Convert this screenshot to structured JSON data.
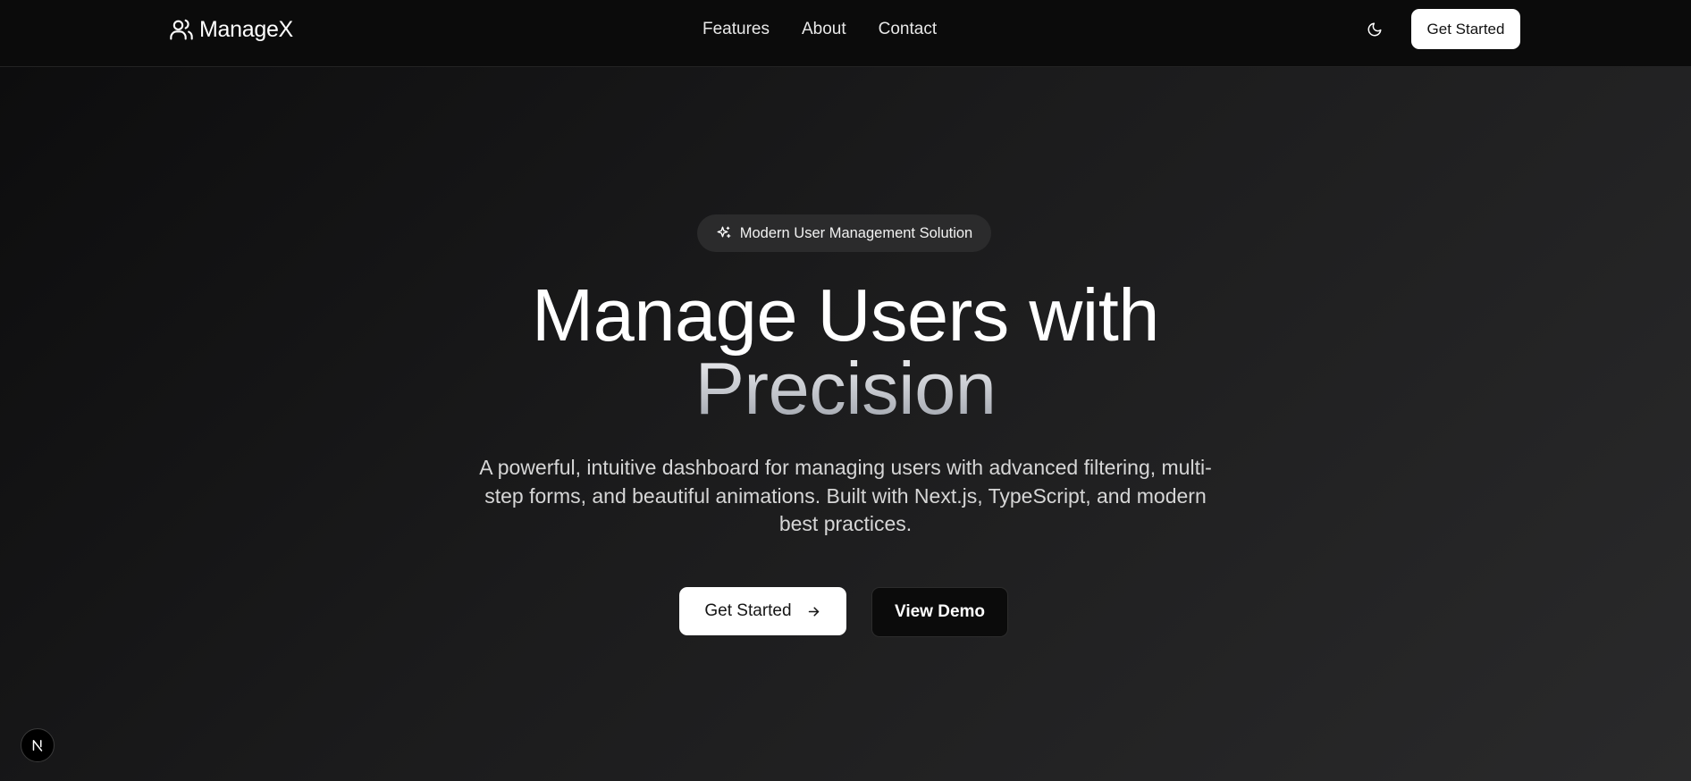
{
  "header": {
    "brand": {
      "name": "ManageX",
      "icon": "users-icon"
    },
    "nav": [
      {
        "label": "Features"
      },
      {
        "label": "About"
      },
      {
        "label": "Contact"
      }
    ],
    "theme_toggle_icon": "moon-icon",
    "cta_label": "Get Started"
  },
  "hero": {
    "badge": {
      "icon": "sparkles-icon",
      "label": "Modern User Management Solution"
    },
    "title_line1": "Manage Users with",
    "title_line2": "Precision",
    "description": "A powerful, intuitive dashboard for managing users with advanced filtering, multi-step forms, and beautiful animations. Built with Next.js, TypeScript, and modern best practices.",
    "primary_cta": {
      "label": "Get Started",
      "icon": "arrow-right-icon"
    },
    "secondary_cta": {
      "label": "View Demo"
    }
  },
  "dev_badge": {
    "icon": "nextjs-logo-icon",
    "label": "N"
  },
  "colors": {
    "background_start": "#0c0c0d",
    "background_end": "#2a2a2b",
    "header_bg": "#0b0b0b",
    "button_light": "#ffffff",
    "button_dark": "#0b0b0b",
    "badge_bg": "#2b2b2c"
  }
}
